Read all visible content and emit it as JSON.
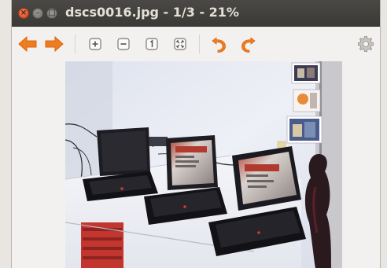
{
  "window": {
    "title": "dscs0016.jpg - 1/3 - 21%",
    "filename": "dscs0016.jpg",
    "image_index": 1,
    "image_count": 3,
    "zoom_percent": 21
  },
  "controls": {
    "close_glyph": "×",
    "minimize_glyph": "–",
    "maximize_glyph": "□"
  },
  "toolbar": {
    "buttons": [
      {
        "name": "previous-image",
        "icon": "arrow-left-icon"
      },
      {
        "name": "next-image",
        "icon": "arrow-right-icon"
      },
      {
        "name": "zoom-in",
        "icon": "zoom-in-icon"
      },
      {
        "name": "zoom-out",
        "icon": "zoom-out-icon"
      },
      {
        "name": "normal-size",
        "icon": "one-to-one-icon"
      },
      {
        "name": "best-fit",
        "icon": "fit-icon"
      },
      {
        "name": "rotate-left",
        "icon": "rotate-left-icon"
      },
      {
        "name": "rotate-right",
        "icon": "rotate-right-icon"
      },
      {
        "name": "preferences",
        "icon": "gear-icon"
      }
    ]
  },
  "colors": {
    "titlebar": "#3c3b37",
    "accent_orange": "#f07c20",
    "window_bg": "#f3f1ef"
  }
}
